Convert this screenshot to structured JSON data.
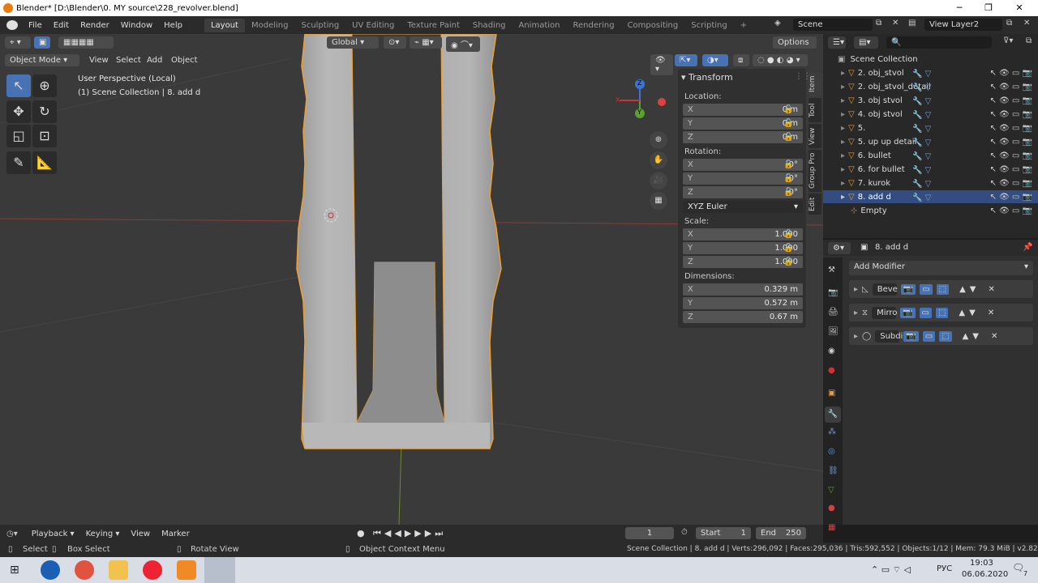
{
  "window": {
    "title": "Blender* [D:\\Blender\\0. MY source\\228_revolver.blend]"
  },
  "menus": [
    "File",
    "Edit",
    "Render",
    "Window",
    "Help"
  ],
  "workspaces": [
    "Layout",
    "Modeling",
    "Sculpting",
    "UV Editing",
    "Texture Paint",
    "Shading",
    "Animation",
    "Rendering",
    "Compositing",
    "Scripting"
  ],
  "active_workspace": "Layout",
  "scene": {
    "name": "Scene",
    "view_layer": "View Layer2"
  },
  "header": {
    "orientation": "Global",
    "options": "Options"
  },
  "viewport": {
    "mode": "Object Mode",
    "menus": [
      "View",
      "Select",
      "Add",
      "Object"
    ],
    "info_line1": "User Perspective (Local)",
    "info_line2": "(1) Scene Collection | 8. add d",
    "gizmo": {
      "x": "X",
      "y": "Y",
      "z": "Z"
    }
  },
  "tabs": [
    "Item",
    "Tool",
    "View",
    "Group Pro",
    "Edit"
  ],
  "transform": {
    "title": "Transform",
    "location_label": "Location:",
    "location": [
      {
        "axis": "X",
        "value": "0 m"
      },
      {
        "axis": "Y",
        "value": "0 m"
      },
      {
        "axis": "Z",
        "value": "0 m"
      }
    ],
    "rotation_label": "Rotation:",
    "rotation": [
      {
        "axis": "X",
        "value": "0°"
      },
      {
        "axis": "Y",
        "value": "0°"
      },
      {
        "axis": "Z",
        "value": "0°"
      }
    ],
    "rotation_mode": "XYZ Euler",
    "scale_label": "Scale:",
    "scale": [
      {
        "axis": "X",
        "value": "1.000"
      },
      {
        "axis": "Y",
        "value": "1.000"
      },
      {
        "axis": "Z",
        "value": "1.000"
      }
    ],
    "dimensions_label": "Dimensions:",
    "dimensions": [
      {
        "axis": "X",
        "value": "0.329 m"
      },
      {
        "axis": "Y",
        "value": "0.572 m"
      },
      {
        "axis": "Z",
        "value": "0.67 m"
      }
    ]
  },
  "outliner": {
    "root": "Scene Collection",
    "items": [
      "2. obj_stvol",
      "2. obj_stvol_detail",
      "3. obj stvol",
      "4. obj stvol",
      "5.",
      "5. up up detail",
      "6. bullet",
      "6. for bullet",
      "7. kurok",
      "8. add d",
      "Empty"
    ],
    "selected": "8. add d"
  },
  "properties": {
    "object": "8. add d",
    "add_modifier": "Add Modifier",
    "modifiers": [
      "Beve",
      "Mirro",
      "Subdi"
    ]
  },
  "timeline": {
    "menus": [
      "Playback",
      "Keying",
      "View",
      "Marker"
    ],
    "current_frame": "1",
    "start_label": "Start",
    "start": "1",
    "end_label": "End",
    "end": "250"
  },
  "statusbar": {
    "select": "Select",
    "box_select": "Box Select",
    "rotate_view": "Rotate View",
    "context_menu": "Object Context Menu",
    "stats": "Scene Collection | 8. add d | Verts:296,092 | Faces:295,036 | Tris:592,552 | Objects:1/12 | Mem: 79.3 MiB | v2.82.7"
  },
  "taskbar": {
    "lang": "РУС",
    "time": "19:03",
    "date": "06.06.2020",
    "notifications": "7"
  }
}
